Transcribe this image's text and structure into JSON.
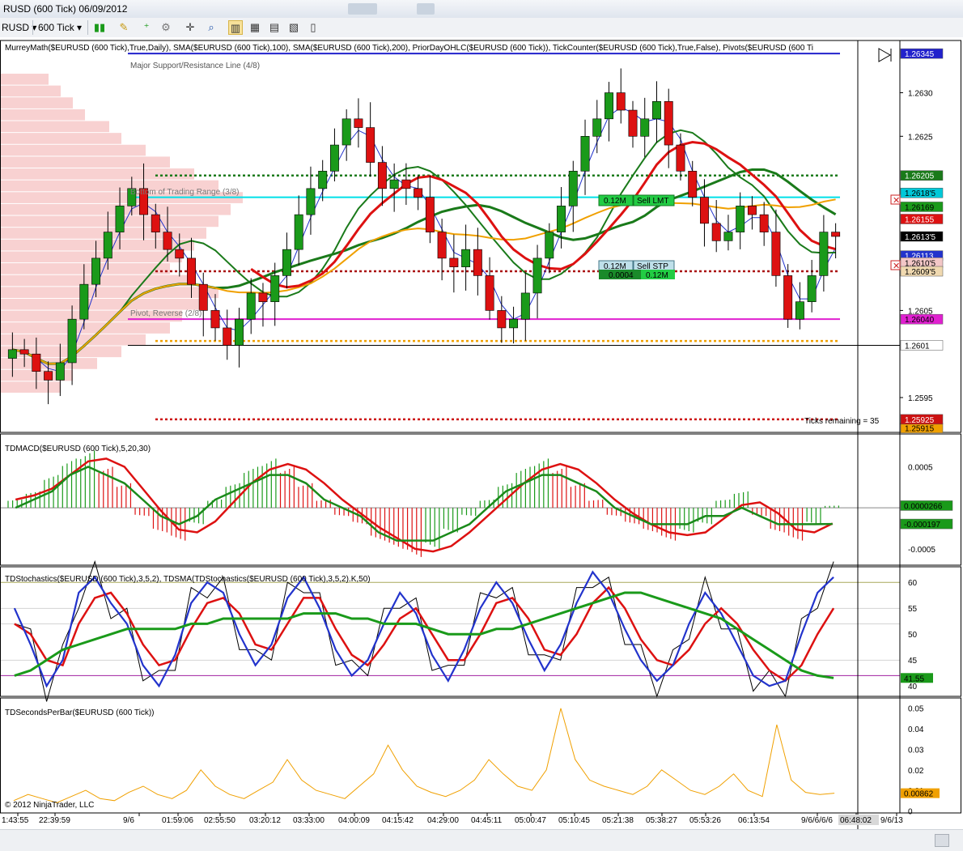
{
  "window": {
    "title": "RUSD (600 Tick)  06/09/2012"
  },
  "toolbar": {
    "instrument": "RUSD",
    "period": "600 Tick",
    "icons": [
      "bar-type-icon",
      "draw-pencil-icon",
      "add-indicator-icon",
      "strategy-icon",
      "crosshair-icon",
      "zoom-icon",
      "chart-style-icon",
      "data-box-icon",
      "properties-icon",
      "template-icon"
    ]
  },
  "chart": {
    "indicator_label": "MurreyMath($EURUSD (600 Tick),True,Daily), SMA($EURUSD (600 Tick),100), SMA($EURUSD (600 Tick),200), PriorDayOHLC($EURUSD (600 Tick)), TickCounter($EURUSD (600 Tick),True,False), Pivots($EURUSD (600 Ti",
    "copyright": "© 2012 NinjaTrader, LLC",
    "ticks_remaining": "Ticks remaining = 35",
    "annotations": {
      "major_support": "Major Support/Resistance Line (4/8)",
      "bottom_range": "Bottom of Trading Range (3/8)",
      "pivot_reverse": "Pivot, Reverse (2/8)"
    },
    "orders": {
      "sell_lmt_qty": "0.12M",
      "sell_lmt_label": "Sell LMT",
      "sell_stp_qty": "0.12M",
      "sell_stp_label": "Sell STP",
      "pos_pnl": "0.0004",
      "pos_qty": "0.12M"
    }
  },
  "chart_data": [
    {
      "type": "line",
      "title": "",
      "instrument": "$EURUSD (600 Tick)",
      "y_ticks": [
        "1.2630",
        "1.2625",
        "1.2605",
        "1.2595"
      ],
      "ylim": [
        1.2591,
        1.2636
      ],
      "price_markers": [
        {
          "label": "1.26345",
          "value": 1.26345,
          "color": "#2222cc"
        },
        {
          "label": "1.26205",
          "value": 1.26205,
          "color": "#1a7a1a"
        },
        {
          "label": "1.2618'5",
          "value": 1.26185,
          "color": "#00c8d8"
        },
        {
          "label": "1.26169",
          "value": 1.26169,
          "color": "#1a9a1a"
        },
        {
          "label": "1.26155",
          "value": 1.26155,
          "color": "#dd1111"
        },
        {
          "label": "1.2613'5",
          "value": 1.26135,
          "color": "#000000"
        },
        {
          "label": "1.26113",
          "value": 1.26113,
          "color": "#2233cc"
        },
        {
          "label": "1.2610'5",
          "value": 1.26105,
          "color": "#f3c7c7"
        },
        {
          "label": "1.2609'5",
          "value": 1.26095,
          "color": "#f0d9b0"
        },
        {
          "label": "1.26040",
          "value": 1.2604,
          "color": "#e020d0"
        },
        {
          "label": "1.25915",
          "value": 1.25915,
          "color": "#f0a000"
        },
        {
          "label": "1.2601",
          "value": 1.2601,
          "color": "#ffffff"
        },
        {
          "label": "1.25925",
          "value": 1.25925,
          "color": "#cc1111"
        }
      ],
      "horizontal_lines": [
        {
          "name": "major-support-line",
          "value": 1.26345,
          "color": "#2222cc",
          "style": "solid"
        },
        {
          "name": "bottom-range-line",
          "value": 1.2618,
          "color": "#00e0e8",
          "style": "solid"
        },
        {
          "name": "pivot-reverse-line",
          "value": 1.2604,
          "color": "#e020d0",
          "style": "solid"
        },
        {
          "name": "prior-high-line",
          "value": 1.26205,
          "color": "#1a7a1a",
          "style": "dotted"
        },
        {
          "name": "prior-close-line",
          "value": 1.26095,
          "color": "#aa1111",
          "style": "dotted"
        },
        {
          "name": "prior-open-line",
          "value": 1.26015,
          "color": "#f0a000",
          "style": "dotted"
        },
        {
          "name": "prior-low-line",
          "value": 1.25925,
          "color": "#cc1111",
          "style": "dotted"
        },
        {
          "name": "last-price-line",
          "value": 1.2601,
          "color": "#000000",
          "style": "solid"
        }
      ],
      "closes": [
        1.26005,
        1.26,
        1.2598,
        1.2597,
        1.2599,
        1.2604,
        1.2608,
        1.2611,
        1.2614,
        1.2617,
        1.2619,
        1.2616,
        1.2614,
        1.2612,
        1.2611,
        1.2608,
        1.2605,
        1.2603,
        1.2601,
        1.2604,
        1.2607,
        1.2606,
        1.2609,
        1.2612,
        1.2616,
        1.2619,
        1.2621,
        1.2624,
        1.2627,
        1.2626,
        1.2622,
        1.2619,
        1.262,
        1.2619,
        1.2618,
        1.2614,
        1.2611,
        1.261,
        1.2612,
        1.2609,
        1.2605,
        1.2603,
        1.2604,
        1.2607,
        1.2611,
        1.2614,
        1.2617,
        1.2621,
        1.2625,
        1.2627,
        1.263,
        1.2628,
        1.2625,
        1.2627,
        1.2629,
        1.2624,
        1.2621,
        1.2618,
        1.2615,
        1.2613,
        1.2614,
        1.2617,
        1.2616,
        1.2614,
        1.2609,
        1.2604,
        1.2606,
        1.2609,
        1.2614,
        1.26135
      ],
      "volume_profile": [
        0.2,
        0.25,
        0.3,
        0.35,
        0.45,
        0.5,
        0.6,
        0.7,
        0.8,
        0.9,
        1.0,
        0.95,
        0.9,
        0.85,
        0.8,
        0.75,
        0.7,
        0.8,
        0.9,
        0.85,
        0.75,
        0.7,
        0.6,
        0.5,
        0.4,
        0.3,
        0.25
      ]
    },
    {
      "type": "bar",
      "title": "",
      "label": "TDMACD($EURUSD (600 Tick),5,20,30)",
      "y_ticks": [
        "0.0005",
        "-0.0005"
      ],
      "ylim": [
        -0.0007,
        0.0009
      ],
      "markers": [
        {
          "label": "0.0000266",
          "value": 2.66e-05,
          "color": "#1a9a1a"
        },
        {
          "label": "-0.000197",
          "value": -0.000197,
          "color": "#1a9a1a"
        }
      ],
      "histogram": [
        0.0001,
        0.0002,
        0.0004,
        0.0006,
        0.0007,
        0.0005,
        0.0003,
        -0.0001,
        -0.0003,
        -0.0004,
        -0.0002,
        0.0001,
        0.0003,
        0.0005,
        0.0006,
        0.0005,
        0.0003,
        0.0001,
        -0.0001,
        -0.0002,
        -0.0004,
        -0.0005,
        -0.0006,
        -0.0005,
        -0.0003,
        -0.0001,
        0.0001,
        0.0003,
        0.0005,
        0.0006,
        0.0005,
        0.0003,
        0.0001,
        -0.0001,
        -0.0002,
        -0.0003,
        -0.0004,
        -0.0003,
        -0.0002,
        0.0001,
        0.0002,
        -0.0001,
        -0.0003,
        -0.0004,
        -0.0002,
        2.66e-05
      ],
      "signal": [
        0.0,
        0.0001,
        0.0002,
        0.0004,
        0.0005,
        0.0004,
        0.0003,
        0.0001,
        -0.0001,
        -0.0002,
        -0.0001,
        0.0001,
        0.0002,
        0.0003,
        0.0004,
        0.0004,
        0.0003,
        0.0001,
        0.0,
        -0.0001,
        -0.0003,
        -0.0004,
        -0.0004,
        -0.0004,
        -0.0003,
        -0.0002,
        0.0,
        0.0002,
        0.0003,
        0.0004,
        0.0004,
        0.0003,
        0.0002,
        0.0,
        -0.0001,
        -0.0002,
        -0.0002,
        -0.0002,
        -0.0001,
        -0.0001,
        0.0,
        -0.0001,
        -0.0002,
        -0.0002,
        -0.0002,
        -0.000197
      ]
    },
    {
      "type": "line",
      "title": "",
      "label": "TDStochastics($EURUSD (600 Tick),3,5,2), TDSMA(TDStochastics($EURUSD (600 Tick),3,5,2).K,50)",
      "y_ticks": [
        "60",
        "55",
        "50",
        "45",
        "40"
      ],
      "ylim": [
        38,
        63
      ],
      "ref_lines": [
        {
          "value": 60,
          "color": "#a8a85a"
        },
        {
          "value": 42,
          "color": "#a020a0"
        }
      ],
      "marker": {
        "label": "41.55",
        "value": 41.55,
        "color": "#1a9a1a"
      },
      "k": [
        55,
        48,
        40,
        45,
        58,
        61,
        56,
        52,
        44,
        40,
        46,
        56,
        60,
        58,
        50,
        44,
        48,
        57,
        61,
        55,
        47,
        42,
        45,
        52,
        58,
        54,
        46,
        41,
        47,
        55,
        60,
        56,
        49,
        43,
        48,
        56,
        62,
        58,
        51,
        45,
        41,
        44,
        52,
        58,
        54,
        48,
        42,
        40,
        41,
        50,
        58,
        61
      ],
      "d": [
        52,
        50,
        45,
        44,
        52,
        57,
        58,
        54,
        48,
        44,
        45,
        51,
        56,
        57,
        54,
        48,
        47,
        52,
        57,
        57,
        51,
        46,
        44,
        48,
        53,
        55,
        50,
        45,
        45,
        50,
        56,
        57,
        53,
        47,
        46,
        50,
        56,
        59,
        55,
        49,
        45,
        44,
        47,
        52,
        55,
        52,
        47,
        43,
        41,
        44,
        50,
        55
      ],
      "sma": [
        42,
        43,
        45,
        47,
        48,
        49,
        50,
        51,
        51,
        51,
        51,
        52,
        52,
        53,
        53,
        53,
        53,
        53,
        54,
        54,
        54,
        53,
        53,
        52,
        52,
        52,
        51,
        50,
        50,
        50,
        51,
        51,
        52,
        53,
        54,
        55,
        56,
        57,
        58,
        58,
        57,
        56,
        55,
        54,
        53,
        51,
        49,
        47,
        45,
        43,
        42,
        41.55
      ]
    },
    {
      "type": "line",
      "title": "",
      "label": "TDSecondsPerBar($EURUSD (600 Tick))",
      "y_ticks": [
        "0.05",
        "0.04",
        "0.03",
        "0.02",
        "0.01",
        "0"
      ],
      "ylim": [
        -0.001,
        0.055
      ],
      "marker": {
        "label": "0.00862",
        "value": 0.00862,
        "color": "#f0a000"
      },
      "values": [
        0.005,
        0.008,
        0.006,
        0.004,
        0.007,
        0.01,
        0.006,
        0.005,
        0.009,
        0.012,
        0.008,
        0.006,
        0.01,
        0.02,
        0.012,
        0.008,
        0.006,
        0.01,
        0.014,
        0.025,
        0.015,
        0.01,
        0.008,
        0.006,
        0.012,
        0.018,
        0.032,
        0.02,
        0.012,
        0.009,
        0.007,
        0.01,
        0.015,
        0.025,
        0.018,
        0.012,
        0.01,
        0.02,
        0.05,
        0.025,
        0.015,
        0.012,
        0.01,
        0.008,
        0.012,
        0.02,
        0.015,
        0.01,
        0.008,
        0.012,
        0.018,
        0.01,
        0.007,
        0.042,
        0.015,
        0.009,
        0.008,
        0.00862
      ]
    }
  ],
  "time_axis": {
    "labels": [
      "1:43:55",
      "22:39:59",
      "9/6",
      "01:59:06",
      "02:55:50",
      "03:20:12",
      "03:33:00",
      "04:00:09",
      "04:15:42",
      "04:29:00",
      "04:45:11",
      "05:00:47",
      "05:10:45",
      "05:21:38",
      "05:38:27",
      "05:53:26",
      "06:13:54",
      "9/6/6/6/6",
      "06:48:02",
      "9/6/13"
    ]
  },
  "colors": {
    "candle_up": "#1a9a1a",
    "candle_down": "#dd1111",
    "sma_fast": "#dd1111",
    "sma_slow": "#1a7a1a",
    "sma_200": "#f0a000",
    "sma_blue": "#2233cc"
  }
}
